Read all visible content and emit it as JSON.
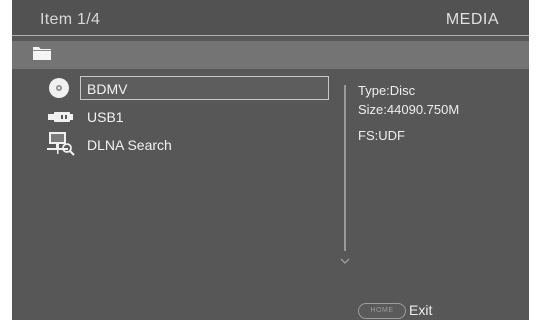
{
  "header": {
    "item_count": "Item 1/4",
    "title": "MEDIA"
  },
  "sources": [
    {
      "label": "BDMV",
      "icon": "disc-icon",
      "selected": true
    },
    {
      "label": "USB1",
      "icon": "usb-icon",
      "selected": false
    },
    {
      "label": "DLNA Search",
      "icon": "dlna-search-icon",
      "selected": false
    }
  ],
  "info": {
    "type": "Type:Disc",
    "size": "Size:44090.750M",
    "fs": "FS:UDF"
  },
  "footer": {
    "home_key": "HOME",
    "exit_label": "Exit"
  },
  "colors": {
    "background": "#575757",
    "header": "#525252",
    "pathbar": "#747474",
    "text": "#eeeeee"
  }
}
